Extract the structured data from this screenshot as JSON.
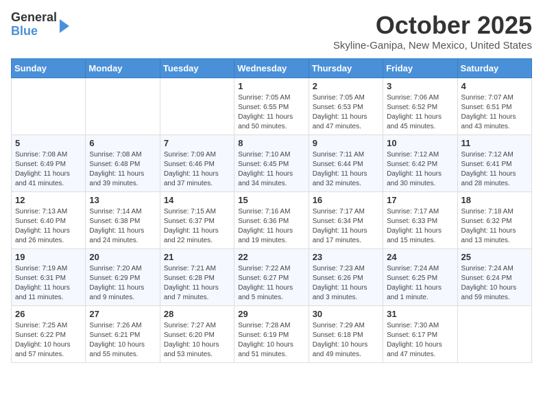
{
  "logo": {
    "general": "General",
    "blue": "Blue"
  },
  "header": {
    "month": "October 2025",
    "location": "Skyline-Ganipa, New Mexico, United States"
  },
  "weekdays": [
    "Sunday",
    "Monday",
    "Tuesday",
    "Wednesday",
    "Thursday",
    "Friday",
    "Saturday"
  ],
  "weeks": [
    [
      {
        "day": "",
        "info": ""
      },
      {
        "day": "",
        "info": ""
      },
      {
        "day": "",
        "info": ""
      },
      {
        "day": "1",
        "info": "Sunrise: 7:05 AM\nSunset: 6:55 PM\nDaylight: 11 hours\nand 50 minutes."
      },
      {
        "day": "2",
        "info": "Sunrise: 7:05 AM\nSunset: 6:53 PM\nDaylight: 11 hours\nand 47 minutes."
      },
      {
        "day": "3",
        "info": "Sunrise: 7:06 AM\nSunset: 6:52 PM\nDaylight: 11 hours\nand 45 minutes."
      },
      {
        "day": "4",
        "info": "Sunrise: 7:07 AM\nSunset: 6:51 PM\nDaylight: 11 hours\nand 43 minutes."
      }
    ],
    [
      {
        "day": "5",
        "info": "Sunrise: 7:08 AM\nSunset: 6:49 PM\nDaylight: 11 hours\nand 41 minutes."
      },
      {
        "day": "6",
        "info": "Sunrise: 7:08 AM\nSunset: 6:48 PM\nDaylight: 11 hours\nand 39 minutes."
      },
      {
        "day": "7",
        "info": "Sunrise: 7:09 AM\nSunset: 6:46 PM\nDaylight: 11 hours\nand 37 minutes."
      },
      {
        "day": "8",
        "info": "Sunrise: 7:10 AM\nSunset: 6:45 PM\nDaylight: 11 hours\nand 34 minutes."
      },
      {
        "day": "9",
        "info": "Sunrise: 7:11 AM\nSunset: 6:44 PM\nDaylight: 11 hours\nand 32 minutes."
      },
      {
        "day": "10",
        "info": "Sunrise: 7:12 AM\nSunset: 6:42 PM\nDaylight: 11 hours\nand 30 minutes."
      },
      {
        "day": "11",
        "info": "Sunrise: 7:12 AM\nSunset: 6:41 PM\nDaylight: 11 hours\nand 28 minutes."
      }
    ],
    [
      {
        "day": "12",
        "info": "Sunrise: 7:13 AM\nSunset: 6:40 PM\nDaylight: 11 hours\nand 26 minutes."
      },
      {
        "day": "13",
        "info": "Sunrise: 7:14 AM\nSunset: 6:38 PM\nDaylight: 11 hours\nand 24 minutes."
      },
      {
        "day": "14",
        "info": "Sunrise: 7:15 AM\nSunset: 6:37 PM\nDaylight: 11 hours\nand 22 minutes."
      },
      {
        "day": "15",
        "info": "Sunrise: 7:16 AM\nSunset: 6:36 PM\nDaylight: 11 hours\nand 19 minutes."
      },
      {
        "day": "16",
        "info": "Sunrise: 7:17 AM\nSunset: 6:34 PM\nDaylight: 11 hours\nand 17 minutes."
      },
      {
        "day": "17",
        "info": "Sunrise: 7:17 AM\nSunset: 6:33 PM\nDaylight: 11 hours\nand 15 minutes."
      },
      {
        "day": "18",
        "info": "Sunrise: 7:18 AM\nSunset: 6:32 PM\nDaylight: 11 hours\nand 13 minutes."
      }
    ],
    [
      {
        "day": "19",
        "info": "Sunrise: 7:19 AM\nSunset: 6:31 PM\nDaylight: 11 hours\nand 11 minutes."
      },
      {
        "day": "20",
        "info": "Sunrise: 7:20 AM\nSunset: 6:29 PM\nDaylight: 11 hours\nand 9 minutes."
      },
      {
        "day": "21",
        "info": "Sunrise: 7:21 AM\nSunset: 6:28 PM\nDaylight: 11 hours\nand 7 minutes."
      },
      {
        "day": "22",
        "info": "Sunrise: 7:22 AM\nSunset: 6:27 PM\nDaylight: 11 hours\nand 5 minutes."
      },
      {
        "day": "23",
        "info": "Sunrise: 7:23 AM\nSunset: 6:26 PM\nDaylight: 11 hours\nand 3 minutes."
      },
      {
        "day": "24",
        "info": "Sunrise: 7:24 AM\nSunset: 6:25 PM\nDaylight: 11 hours\nand 1 minute."
      },
      {
        "day": "25",
        "info": "Sunrise: 7:24 AM\nSunset: 6:24 PM\nDaylight: 10 hours\nand 59 minutes."
      }
    ],
    [
      {
        "day": "26",
        "info": "Sunrise: 7:25 AM\nSunset: 6:22 PM\nDaylight: 10 hours\nand 57 minutes."
      },
      {
        "day": "27",
        "info": "Sunrise: 7:26 AM\nSunset: 6:21 PM\nDaylight: 10 hours\nand 55 minutes."
      },
      {
        "day": "28",
        "info": "Sunrise: 7:27 AM\nSunset: 6:20 PM\nDaylight: 10 hours\nand 53 minutes."
      },
      {
        "day": "29",
        "info": "Sunrise: 7:28 AM\nSunset: 6:19 PM\nDaylight: 10 hours\nand 51 minutes."
      },
      {
        "day": "30",
        "info": "Sunrise: 7:29 AM\nSunset: 6:18 PM\nDaylight: 10 hours\nand 49 minutes."
      },
      {
        "day": "31",
        "info": "Sunrise: 7:30 AM\nSunset: 6:17 PM\nDaylight: 10 hours\nand 47 minutes."
      },
      {
        "day": "",
        "info": ""
      }
    ]
  ]
}
